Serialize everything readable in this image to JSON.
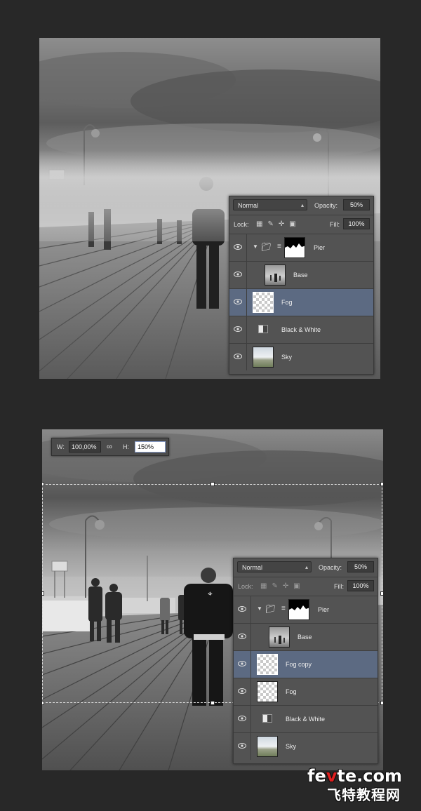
{
  "panel_top": {
    "blend_mode": "Normal",
    "opacity_label": "Opacity:",
    "opacity_value": "50%",
    "lock_label": "Lock:",
    "fill_label": "Fill:",
    "fill_value": "100%",
    "layers": [
      {
        "name": "Pier",
        "kind": "group",
        "selected": false
      },
      {
        "name": "Base",
        "kind": "photo",
        "selected": false
      },
      {
        "name": "Fog",
        "kind": "transparent",
        "selected": true
      },
      {
        "name": "Black & White",
        "kind": "adjustment",
        "selected": false
      },
      {
        "name": "Sky",
        "kind": "sky",
        "selected": false
      }
    ]
  },
  "transform_bar": {
    "w_label": "W:",
    "w_value": "100,00%",
    "h_label": "H:",
    "h_value": "150%"
  },
  "panel_bottom": {
    "blend_mode": "Normal",
    "opacity_label": "Opacity:",
    "opacity_value": "50%",
    "lock_label": "Lock:",
    "fill_label": "Fill:",
    "fill_value": "100%",
    "layers": [
      {
        "name": "Pier",
        "kind": "group",
        "selected": false
      },
      {
        "name": "Base",
        "kind": "photo",
        "selected": false
      },
      {
        "name": "Fog copy",
        "kind": "transparent",
        "selected": true
      },
      {
        "name": "Fog",
        "kind": "transparent",
        "selected": false
      },
      {
        "name": "Black & White",
        "kind": "adjustment",
        "selected": false
      },
      {
        "name": "Sky",
        "kind": "sky",
        "selected": false
      }
    ]
  },
  "watermark": {
    "domain_prefix": "fe",
    "domain_accent": "v",
    "domain_suffix": "te.com",
    "chinese": "飞特教程网"
  },
  "colors": {
    "background": "#282828",
    "panel": "#535353",
    "selected_layer": "#5c6a82"
  }
}
